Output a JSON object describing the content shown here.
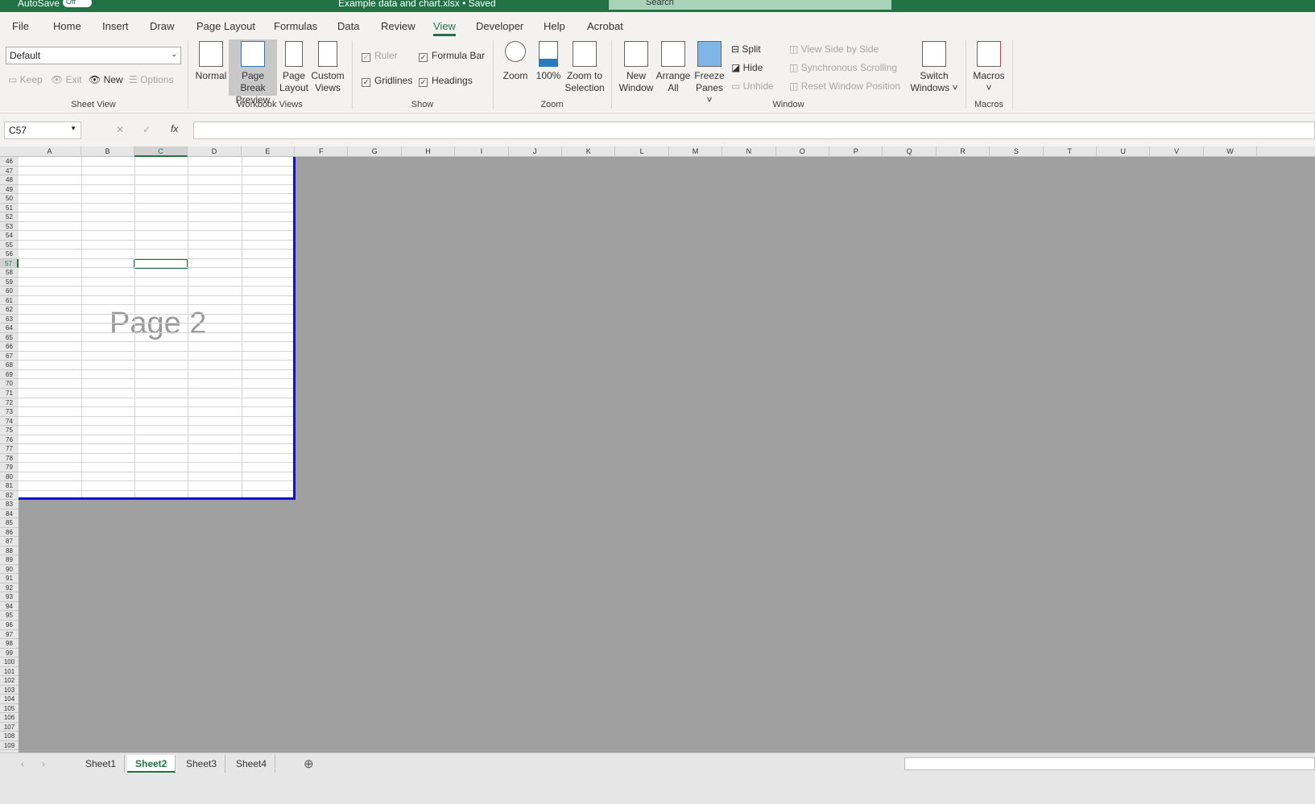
{
  "title_bar": {
    "autosave_label": "AutoSave",
    "autosave_state": "Off",
    "file_title": "Example data and chart.xlsx • Saved",
    "search_placeholder": "Search"
  },
  "menu_tabs": [
    {
      "label": "File"
    },
    {
      "label": "Home"
    },
    {
      "label": "Insert"
    },
    {
      "label": "Draw"
    },
    {
      "label": "Page Layout"
    },
    {
      "label": "Formulas"
    },
    {
      "label": "Data"
    },
    {
      "label": "Review"
    },
    {
      "label": "View",
      "active": true
    },
    {
      "label": "Developer"
    },
    {
      "label": "Help"
    },
    {
      "label": "Acrobat"
    }
  ],
  "ribbon": {
    "sheet_view": {
      "style_value": "Default",
      "keep": "Keep",
      "exit": "Exit",
      "new": "New",
      "options": "Options",
      "label": "Sheet View"
    },
    "workbook_views": {
      "normal": "Normal",
      "page_break_1": "Page Break",
      "page_break_2": "Preview",
      "page_layout_1": "Page",
      "page_layout_2": "Layout",
      "custom_1": "Custom",
      "custom_2": "Views",
      "label": "Workbook Views"
    },
    "show": {
      "ruler": "Ruler",
      "formula_bar": "Formula Bar",
      "gridlines": "Gridlines",
      "headings": "Headings",
      "label": "Show"
    },
    "zoom": {
      "zoom": "Zoom",
      "hundred": "100%",
      "zts_1": "Zoom to",
      "zts_2": "Selection",
      "label": "Zoom"
    },
    "window": {
      "new_1": "New",
      "new_2": "Window",
      "arrange_1": "Arrange",
      "arrange_2": "All",
      "freeze_1": "Freeze",
      "freeze_2": "Panes ˅",
      "split": "Split",
      "hide": "Hide",
      "unhide": "Unhide",
      "side_by_side": "View Side by Side",
      "sync": "Synchronous Scrolling",
      "reset": "Reset Window Position",
      "switch_1": "Switch",
      "switch_2": "Windows ˅",
      "label": "Window"
    },
    "macros": {
      "macros": "Macros",
      "label": "Macros"
    }
  },
  "formula_bar": {
    "name_box": "C57",
    "fx": "fx",
    "value": ""
  },
  "grid": {
    "columns": [
      "A",
      "B",
      "C",
      "D",
      "E",
      "F",
      "G",
      "H",
      "I",
      "J",
      "K",
      "L",
      "M",
      "N",
      "O",
      "P",
      "Q",
      "R",
      "S",
      "T",
      "U",
      "V",
      "W"
    ],
    "selected_column": "C",
    "first_row": 46,
    "last_row": 109,
    "selected_row": 57,
    "page_last_row": 82,
    "page_label": "Page 2"
  },
  "sheet_tabs": [
    {
      "label": "Sheet1"
    },
    {
      "label": "Sheet2",
      "active": true
    },
    {
      "label": "Sheet3"
    },
    {
      "label": "Sheet4"
    }
  ],
  "colors": {
    "brand": "#217346",
    "page_break": "#1010d0",
    "outside_print_area": "#a0a0a0"
  }
}
